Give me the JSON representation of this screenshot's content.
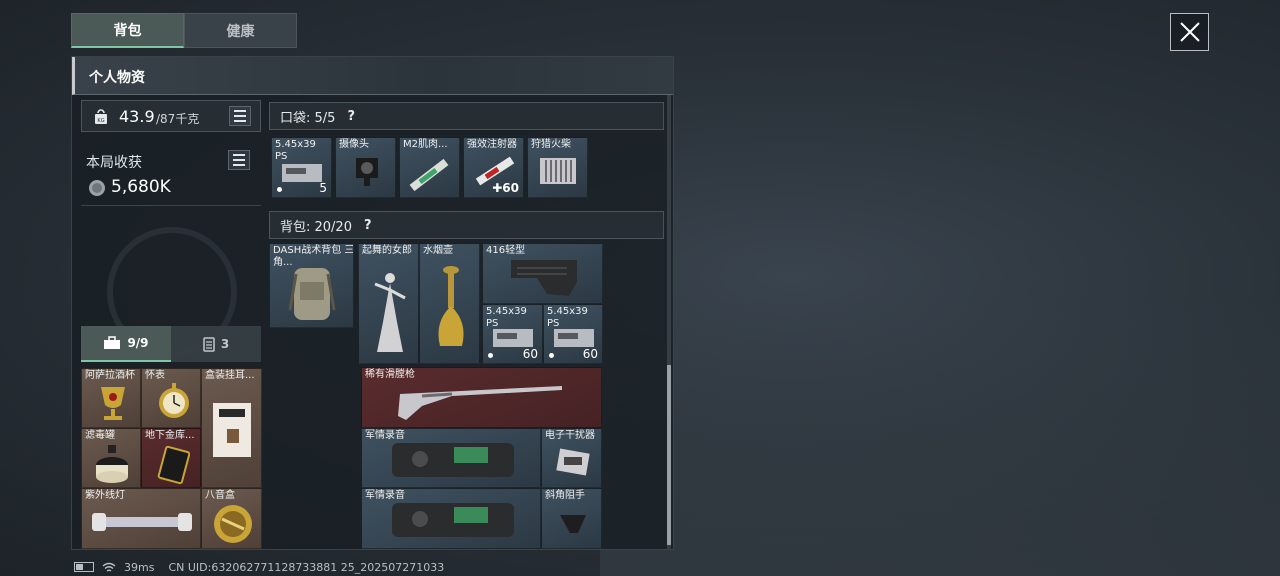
{
  "tabs": [
    {
      "label": "背包"
    },
    {
      "label": "健康"
    }
  ],
  "panel": {
    "title": "个人物资"
  },
  "weight": {
    "current": "43.9",
    "max": "/87千克"
  },
  "harvest": {
    "label": "本局收获",
    "value": "5,680K"
  },
  "subtabs": [
    {
      "label": "9/9"
    },
    {
      "label": "3"
    }
  ],
  "safe_items": [
    {
      "label": "阿萨拉酒杯"
    },
    {
      "label": "怀表"
    },
    {
      "label": "盒装挂耳..."
    },
    {
      "label": "滤毒罐"
    },
    {
      "label": "地下金库..."
    },
    {
      "label": "紫外线灯"
    },
    {
      "label": "八音盒"
    }
  ],
  "pocket": {
    "title": "口袋: 5/5",
    "help": "?",
    "items": [
      {
        "label": "5.45x39 PS",
        "qty": "5"
      },
      {
        "label": "摄像头",
        "qty": ""
      },
      {
        "label": "M2肌肉...",
        "qty": ""
      },
      {
        "label": "强效注射器",
        "qty": "60",
        "prefix": "✚"
      },
      {
        "label": "狩猎火柴",
        "qty": ""
      }
    ]
  },
  "backpack": {
    "title": "背包: 20/20",
    "help": "?",
    "items": [
      {
        "label": "DASH战术背包 三角..."
      },
      {
        "label": "起舞的女郎"
      },
      {
        "label": "水烟壶"
      },
      {
        "label": "416轻型"
      },
      {
        "label": "5.45x39 PS",
        "qty": "60"
      },
      {
        "label": "5.45x39 PS",
        "qty": "60"
      },
      {
        "label": "稀有滑膛枪"
      },
      {
        "label": "军情录音"
      },
      {
        "label": "电子干扰器"
      },
      {
        "label": "军情录音"
      },
      {
        "label": "斜角阻手"
      }
    ]
  },
  "status": {
    "ping": "39ms",
    "uid": "CN UID:632062771128733881 25_202507271033"
  },
  "colors": {
    "accent": "#7fc6a6",
    "panel": "#181e23"
  }
}
